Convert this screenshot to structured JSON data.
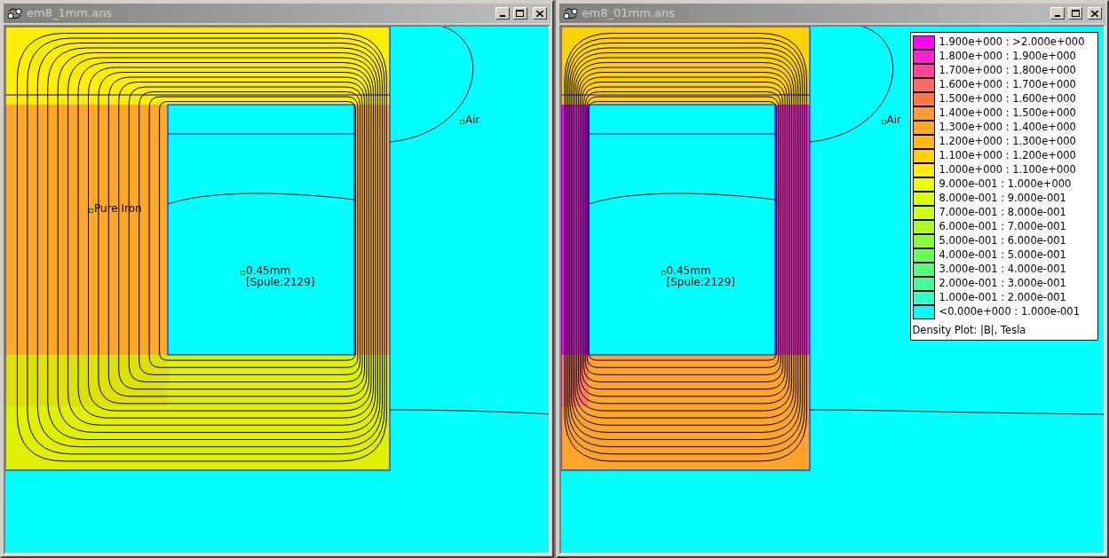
{
  "windows": [
    {
      "title": "em8_1mm.ans",
      "active": false,
      "labels": [
        {
          "lines": [
            "Pure Iron"
          ]
        },
        {
          "lines": [
            "Air"
          ]
        },
        {
          "lines": [
            "0.45mm",
            "[Spule:2129]"
          ]
        }
      ]
    },
    {
      "title": "em8_01mm.ans",
      "active": false,
      "labels": [
        {
          "lines": [
            "Air"
          ]
        },
        {
          "lines": [
            "0.45mm",
            "[Spule:2129]"
          ]
        }
      ],
      "legend": {
        "title": "Density Plot: |B|, Tesla",
        "entries": [
          {
            "label": "1.900e+000 : >2.000e+000",
            "color": "#ff00ff"
          },
          {
            "label": "1.800e+000 : 1.900e+000",
            "color": "#ff22cc"
          },
          {
            "label": "1.700e+000 : 1.800e+000",
            "color": "#ff4499"
          },
          {
            "label": "1.600e+000 : 1.700e+000",
            "color": "#ff6666"
          },
          {
            "label": "1.500e+000 : 1.600e+000",
            "color": "#ff7744"
          },
          {
            "label": "1.400e+000 : 1.500e+000",
            "color": "#ff9933"
          },
          {
            "label": "1.300e+000 : 1.400e+000",
            "color": "#ffaa22"
          },
          {
            "label": "1.200e+000 : 1.300e+000",
            "color": "#ffbb11"
          },
          {
            "label": "1.100e+000 : 1.200e+000",
            "color": "#ffd200"
          },
          {
            "label": "1.000e+000 : 1.100e+000",
            "color": "#ffee00"
          },
          {
            "label": "9.000e-001 : 1.000e+000",
            "color": "#eeff00"
          },
          {
            "label": "8.000e-001 : 9.000e-001",
            "color": "#ddff00"
          },
          {
            "label": "7.000e-001 : 8.000e-001",
            "color": "#ccff11"
          },
          {
            "label": "6.000e-001 : 7.000e-001",
            "color": "#aaff22"
          },
          {
            "label": "5.000e-001 : 6.000e-001",
            "color": "#88ff33"
          },
          {
            "label": "4.000e-001 : 5.000e-001",
            "color": "#66ff55"
          },
          {
            "label": "3.000e-001 : 4.000e-001",
            "color": "#55ff77"
          },
          {
            "label": "2.000e-001 : 3.000e-001",
            "color": "#44ff99"
          },
          {
            "label": "1.000e-001 : 2.000e-001",
            "color": "#33ffcc"
          },
          {
            "label": "<0.000e+000 : 1.000e-001",
            "color": "#00ffff"
          }
        ]
      }
    }
  ]
}
